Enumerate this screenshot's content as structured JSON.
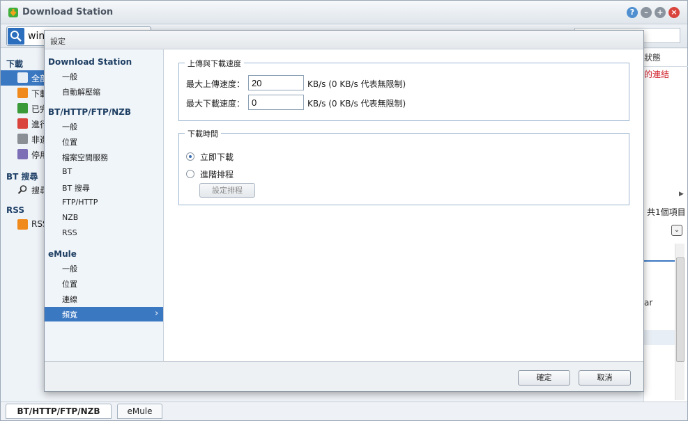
{
  "app": {
    "title": "Download Station",
    "search_value": "win",
    "window_buttons": {
      "help": "?",
      "minimize": "–",
      "maximize": "+",
      "close": "×"
    }
  },
  "sidebar": {
    "section_download": "下載",
    "items": [
      {
        "label": "全部",
        "icon": "list-icon"
      },
      {
        "label": "下載",
        "icon": "download-arrow-icon"
      },
      {
        "label": "已完",
        "icon": "check-icon"
      },
      {
        "label": "進行",
        "icon": "active-icon"
      },
      {
        "label": "非進",
        "icon": "inactive-icon"
      },
      {
        "label": "停用",
        "icon": "pause-icon"
      }
    ],
    "section_bt_search": "BT 搜尋",
    "bt_search_item": "搜尋",
    "section_rss": "RSS",
    "rss_item": "RSS"
  },
  "rightpane": {
    "header": "狀態",
    "red_text": "的連結",
    "count": "共1個項目",
    "partial_text": "ar"
  },
  "bottom_tabs": [
    "BT/HTTP/FTP/NZB",
    "eMule"
  ],
  "modal": {
    "title": "設定",
    "nav": {
      "sections": [
        {
          "title": "Download Station",
          "items": [
            "一般",
            "自動解壓縮"
          ]
        },
        {
          "title": "BT/HTTP/FTP/NZB",
          "items": [
            "一般",
            "位置",
            "檔案空間服務",
            "BT",
            "BT 搜尋",
            "FTP/HTTP",
            "NZB",
            "RSS"
          ]
        },
        {
          "title": "eMule",
          "items": [
            "一般",
            "位置",
            "連線",
            "頻寬"
          ]
        }
      ],
      "active_item": "頻寬"
    },
    "speed_group": {
      "legend": "上傳與下載速度",
      "upload_label": "最大上傳速度：",
      "upload_value": "20",
      "download_label": "最大下載速度：",
      "download_value": "0",
      "unit_note": "KB/s (0 KB/s 代表無限制)"
    },
    "time_group": {
      "legend": "下載時間",
      "radio_now": "立即下載",
      "radio_schedule": "進階排程",
      "schedule_button": "設定排程",
      "selected": "now"
    },
    "footer": {
      "ok": "確定",
      "cancel": "取消"
    }
  }
}
